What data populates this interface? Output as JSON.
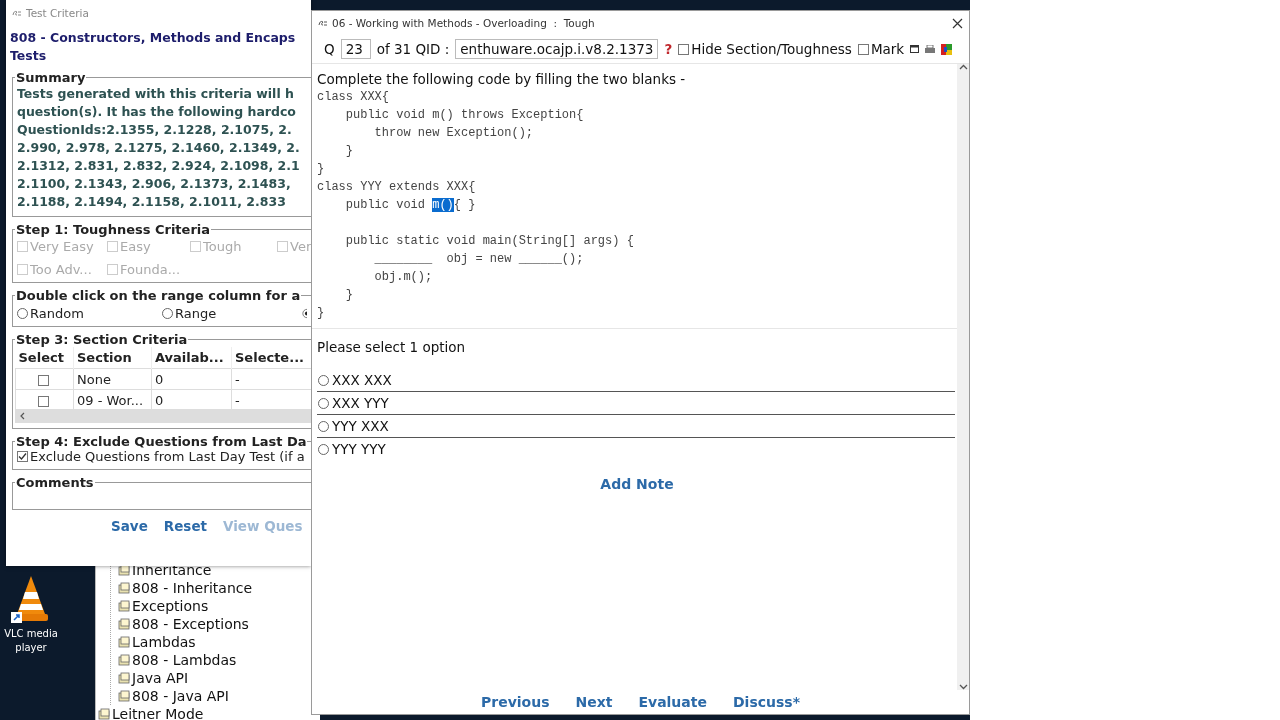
{
  "desktop_icons": [
    {
      "label": "VLC media player"
    }
  ],
  "tree": {
    "items": [
      {
        "children": [
          {
            "label": "Inheritance"
          },
          {
            "label": "808 - Inheritance"
          },
          {
            "label": "Exceptions"
          },
          {
            "label": "808 - Exceptions"
          },
          {
            "label": "Lambdas"
          },
          {
            "label": "808 - Lambdas"
          },
          {
            "label": "Java API"
          },
          {
            "label": "808 - Java API"
          }
        ]
      },
      {
        "label": "Leitner Mode"
      }
    ]
  },
  "criteria_window": {
    "title": "Test Criteria",
    "heading": [
      "808 - Constructors, Methods and Encaps",
      "Tests"
    ],
    "summary": {
      "legend": "Summary",
      "lines": [
        "Tests generated with this criteria will h",
        "question(s). It has the following hardco",
        "QuestionIds:2.1355, 2.1228, 2.1075, 2.",
        "2.990, 2.978, 2.1275, 2.1460, 2.1349, 2.",
        "2.1312, 2.831, 2.832, 2.924, 2.1098, 2.1",
        "2.1100, 2.1343, 2.906, 2.1373, 2.1483,",
        "2.1188, 2.1494, 2.1158, 2.1011, 2.833"
      ]
    },
    "step1": {
      "legend": "Step 1: Toughness Criteria",
      "options": [
        {
          "label": "Very Easy",
          "checked": false,
          "disabled": true
        },
        {
          "label": "Easy",
          "checked": false,
          "disabled": true
        },
        {
          "label": "Tough",
          "checked": false,
          "disabled": true
        },
        {
          "label": "Ver",
          "checked": false,
          "disabled": true
        },
        {
          "label": "Too Adv...",
          "checked": false,
          "disabled": true
        },
        {
          "label": "Founda...",
          "checked": false,
          "disabled": true
        }
      ]
    },
    "step2": {
      "legend": "Double click on the range column for a",
      "options": [
        {
          "label": "Random",
          "selected": false
        },
        {
          "label": "Range",
          "selected": false
        },
        {
          "selected": true
        }
      ]
    },
    "step3": {
      "legend": "Step 3: Section Criteria",
      "select_column": "Select",
      "columns": [
        "Section",
        "Availab...",
        "Selecte..."
      ],
      "rows": [
        {
          "checked": false,
          "cells": [
            "None",
            "0",
            "-"
          ]
        },
        {
          "checked": false,
          "cells": [
            "09 - Wor...",
            "0",
            "-"
          ]
        }
      ]
    },
    "step4": {
      "legend": "Step 4: Exclude Questions from Last Da",
      "option": {
        "label": "Exclude Questions from Last Day Test (if a",
        "checked": true
      }
    },
    "comments": {
      "legend": "Comments"
    },
    "buttons": [
      {
        "label": "Save",
        "disabled": false
      },
      {
        "label": "Reset",
        "disabled": false
      },
      {
        "label": "View Ques",
        "disabled": true
      }
    ]
  },
  "question_window": {
    "title": "06 - Working with Methods - Overloading  :  Tough",
    "q_label": "Q",
    "q_number": "23",
    "of_label": "of 31 QID :",
    "qid": "enthuware.ocajp.i.v8.2.1373",
    "help": "?",
    "toggles": [
      {
        "label": "Hide Section/Toughness",
        "checked": false
      },
      {
        "label": "Mark",
        "checked": false
      }
    ],
    "prompt": "Complete the following code by filling the two blanks -",
    "code": [
      {
        "text": "class XXX{\n    public void m() throws Exception{\n        throw new Exception();\n    }\n}\nclass YYY extends XXX{\n    public void ",
        "selected": false
      },
      {
        "text": "m()",
        "selected": true
      },
      {
        "text": "{ }\n\n    public static void main(String[] args) {\n        ________  obj = new ______();\n        obj.m();\n    }\n}",
        "selected": false
      }
    ],
    "instruction": "Please select 1 option",
    "options": [
      {
        "label": "XXX XXX",
        "selected": false
      },
      {
        "label": "XXX YYY",
        "selected": false
      },
      {
        "label": "YYY XXX",
        "selected": false
      },
      {
        "label": "YYY YYY",
        "selected": false
      }
    ],
    "add_note": "Add Note",
    "nav": [
      "Previous",
      "Next",
      "Evaluate",
      "Discuss*"
    ]
  }
}
